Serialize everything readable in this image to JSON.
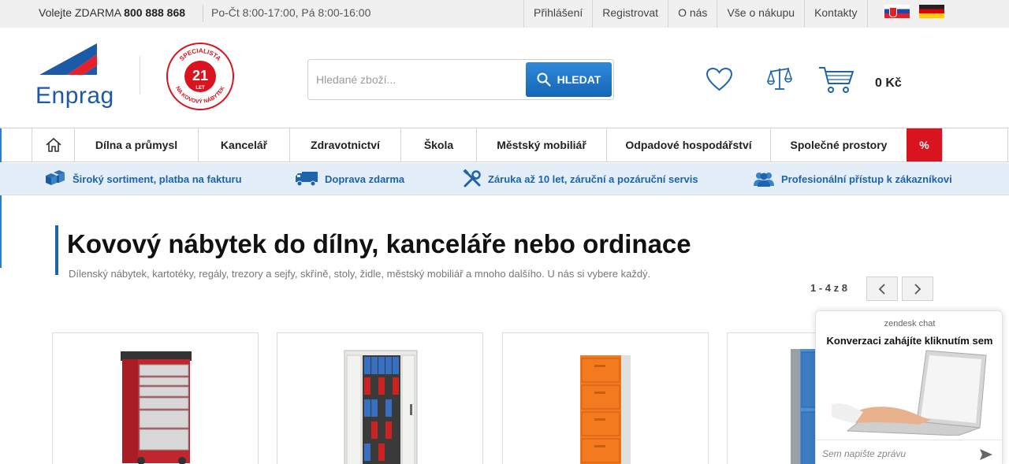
{
  "topbar": {
    "phone_label": "Volejte ZDARMA",
    "phone_number": "800 888 868",
    "hours": "Po-Čt 8:00-17:00, Pá 8:00-16:00",
    "links": [
      "Přihlášení",
      "Registrovat",
      "O nás",
      "Vše o nákupu",
      "Kontakty"
    ]
  },
  "header": {
    "logo_text": "Enprag",
    "badge": {
      "number": "21",
      "unit": "LET",
      "top_text": "SPECIALISTA",
      "bottom_text": "NA KOVOVÝ NÁBYTEK"
    },
    "search": {
      "placeholder": "Hledané zboží...",
      "button_label": "HLEDAT"
    },
    "cart_total": "0 Kč"
  },
  "categories": [
    "Dílna a průmysl",
    "Kancelář",
    "Zdravotnictví",
    "Škola",
    "Městský mobiliář",
    "Odpadové hospodářství",
    "Společné prostory",
    "%"
  ],
  "usps": [
    {
      "icon": "boxes-icon",
      "text": "Široký sortiment, platba na fakturu"
    },
    {
      "icon": "truck-icon",
      "text": "Doprava zdarma"
    },
    {
      "icon": "tools-icon",
      "text": "Záruka až 10 let, záruční a pozáruční servis"
    },
    {
      "icon": "people-icon",
      "text": "Profesionální přístup k zákazníkovi"
    }
  ],
  "hero": {
    "title": "Kovový nábytek do dílny, kanceláře nebo ordinace",
    "subtitle": "Dílenský nábytek, kartotéky, regály, trezory a sejfy, skříně, stoly, židle, městský mobiliář a mnoho dalšího. U nás si vybere každý."
  },
  "pager": {
    "label": "1 - 4 z 8"
  },
  "colors": {
    "brand_blue": "#1c5aa7",
    "accent_red": "#d9141f",
    "usp_bg": "#e3eef8"
  },
  "chat": {
    "brand": "zendesk chat",
    "title": "Konverzaci zahájíte kliknutím sem",
    "input_placeholder": "Sem napište zprávu"
  }
}
